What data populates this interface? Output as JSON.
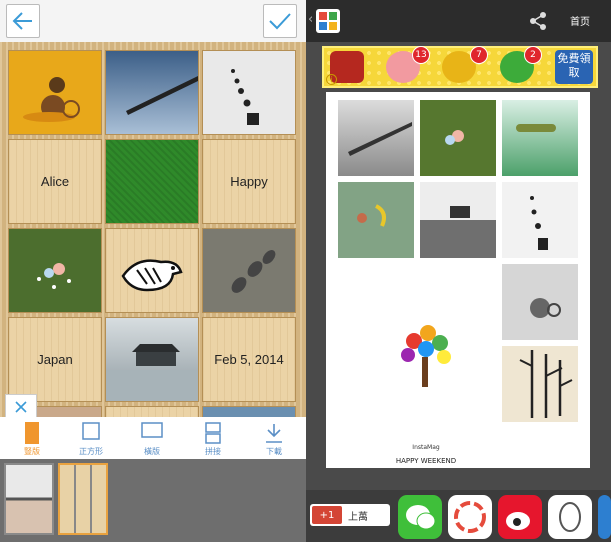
{
  "left": {
    "cells": {
      "alice": "Alice",
      "happy": "Happy",
      "japan": "Japan",
      "date": "Feb 5, 2014"
    },
    "tools": [
      {
        "label": "豎版"
      },
      {
        "label": "正方形"
      },
      {
        "label": "橫版"
      },
      {
        "label": "拼接"
      },
      {
        "label": "下載"
      }
    ]
  },
  "right": {
    "header": {
      "home": "首页"
    },
    "banner": {
      "badges": [
        "13",
        "7",
        "2"
      ],
      "free_label": "免費領取"
    },
    "collage": {
      "brand": "InstaMag",
      "caption": "HAPPY WEEKEND"
    },
    "share": {
      "gplus": "+1",
      "count": "上萬"
    }
  },
  "colors": {
    "accent": "#e9a23f",
    "link": "#5b8fc6"
  }
}
